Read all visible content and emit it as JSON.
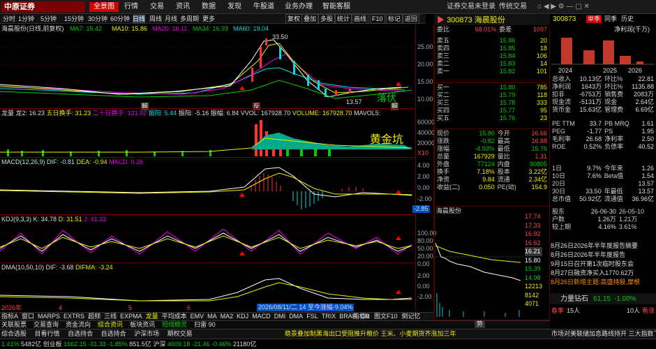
{
  "top_menu": {
    "logo": "中原证券",
    "logo_sub": "CENTRAL CHINA SECURITIES",
    "items": [
      "全景图",
      "行情",
      "交易",
      "资讯",
      "数据",
      "发现",
      "牛股道",
      "业务办理",
      "智能客服"
    ],
    "right": [
      "证券交易未登录",
      "传统交易"
    ]
  },
  "periods": [
    "分时",
    "1分钟",
    "5分钟",
    "15分钟",
    "30分钟",
    "60分钟",
    "日线",
    "周线",
    "月线",
    "多周期",
    "更多"
  ],
  "tools": [
    "复权",
    "叠加",
    "多股",
    "统计",
    "画线",
    "F10",
    "标记",
    "返回"
  ],
  "stock": {
    "code": "300873",
    "name": "海晨股份",
    "chart_title": "海晨股份(日线,前复权)"
  },
  "ma": {
    "ma7": "MA7: 15.42",
    "ma10": "MA10: 15.86",
    "ma20": "MA20: 16.11",
    "ma34": "MA34: 16.93",
    "ma60": "MA60: 19.04"
  },
  "price_axis": [
    "25.00",
    "20.00",
    "15.00",
    "10.00"
  ],
  "price_marks": {
    "high": "33.50",
    "low": "13.57",
    "tag1": "解",
    "tag2": "反",
    "tag3": "解",
    "tag4": "解",
    "tag5": "落伏"
  },
  "vol_ind": {
    "title": "龙量",
    "v1": "龙2: 16.23",
    "v2": "五日换手: 31.23",
    "v3": "二十日换手: 121.92",
    "v4": "振阳: 5.44",
    "v5": "振阳: -5.16",
    "v6": "振幅: 6.84",
    "v7": "VVOL: 167928.70",
    "v8": "VOLUME: 167928.70",
    "v9": "MAVOL5: "
  },
  "vol_axis": [
    "60000",
    "40000",
    "20000",
    "X10"
  ],
  "vol_label": "黄金坑",
  "macd": {
    "title": "MACD(12,26,9)",
    "dif": "DIF: -0.81",
    "dea": "DEA: -0.94",
    "macd": "MACD: 0.26",
    "axis": [
      "4.00",
      "2.00",
      "0.00",
      "-2.00"
    ],
    "current": "-2.85"
  },
  "kdj": {
    "title": "KDJ(9,3,3)",
    "k": "K: 34.78",
    "d": "D: 31.51",
    "j": "J: 41.33",
    "axis": [
      "100.00",
      "80.00",
      "50.00",
      "20.00",
      "0.00"
    ]
  },
  "dma": {
    "title": "DMA(10,50,10)",
    "dif": "DIF: -3.68",
    "difma": "DIFMA: -3.24",
    "axis": [
      "2.00",
      "0.00",
      "-2.00"
    ]
  },
  "time_axis": [
    "2026年",
    "4",
    "5",
    "6"
  ],
  "tooltip": "2026/08/11/二 14 至今涨幅-9.04%",
  "bottom_tabs": [
    "指标A",
    "窗口",
    "MARPS",
    "EXTRS",
    "超频",
    "三线",
    "EXPMA",
    "龙量",
    "平均成本",
    "EMV",
    "MA",
    "MA2",
    "KDJ",
    "MACD",
    "DMI",
    "DMA",
    "FSL",
    "TRIX",
    "BRAR",
    "CR"
  ],
  "bottom_tabs_right": [
    "指标B",
    "图文F10",
    "倒记忆"
  ],
  "lower_tabs": [
    "关联股票",
    "交易查询",
    "资金流向",
    "综合资讯",
    "板块资讯",
    "短线精灵",
    "扫雷 90"
  ],
  "ticker_text": "稳景叠加制黑海出口受阻推升粮价 王米、小麦期货齐涨加三年",
  "status_line": {
    "items": [
      "综合选股",
      "目看行情",
      "自选持合",
      "自选持合",
      "沪深市场",
      "期权交易"
    ],
    "quotes": [
      {
        "label": "1.41%",
        "v": "5482亿"
      },
      {
        "label": "创业板",
        "v": "1662.15"
      },
      {
        "label": "-31.33",
        "v": "-1.85%"
      },
      {
        "label": "851.5亿"
      },
      {
        "label": "沪深",
        "v": "4609.18"
      },
      {
        "label": "-21.46",
        "v": "-0.46%"
      },
      {
        "label": "21180亿"
      }
    ],
    "right": "市场对美联储加息路线持开 三大指数下跌"
  },
  "quote_panel": {
    "code": "300873",
    "name": "海晨股份",
    "weibi_label": "委比",
    "weibi": "68.01%",
    "weicha_label": "委差",
    "weicha": "1097",
    "sell": [
      {
        "l": "卖五",
        "p": "15.86",
        "v": "20"
      },
      {
        "l": "卖四",
        "p": "15.85",
        "v": "18"
      },
      {
        "l": "卖三",
        "p": "15.84",
        "v": "106"
      },
      {
        "l": "卖二",
        "p": "15.83",
        "v": "14"
      },
      {
        "l": "卖一",
        "p": "15.82",
        "v": "101"
      }
    ],
    "buy": [
      {
        "l": "买一",
        "p": "15.80",
        "v": "785"
      },
      {
        "l": "买二",
        "p": "15.79",
        "v": "118"
      },
      {
        "l": "买三",
        "p": "15.78",
        "v": "333"
      },
      {
        "l": "买四",
        "p": "15.77",
        "v": "95"
      },
      {
        "l": "买五",
        "p": "15.76",
        "v": "23"
      }
    ],
    "stats": [
      [
        "现价",
        "15.80",
        "今开",
        "16.66"
      ],
      [
        "涨跌",
        "-0.82",
        "最高",
        "16.88"
      ],
      [
        "涨幅",
        "-4.93%",
        "最低",
        "15.76"
      ],
      [
        "总量",
        "167929",
        "量比",
        "1.31"
      ],
      [
        "外盘",
        "77124",
        "内盘",
        "90805"
      ],
      [
        "换手",
        "7.18%",
        "股本",
        "3.22亿"
      ],
      [
        "净资",
        "9.84",
        "流通",
        "2.34亿"
      ],
      [
        "收益(二)",
        "0.050",
        "PE(动)",
        "154.9"
      ]
    ]
  },
  "mini_chart": {
    "title": "海晨股份",
    "axis": [
      "17.74",
      "17.33",
      "16.92",
      "16.62",
      "16.21",
      "15.80",
      "15.39",
      "14.98",
      "12213",
      "8142",
      "4071"
    ],
    "tab": "势"
  },
  "fin_panel": {
    "code": "300873",
    "tabs": [
      "单季",
      "同季",
      "历史"
    ],
    "chart_label": "净利润(千万)",
    "years": [
      "2024",
      "2025",
      "2026"
    ],
    "rows": [
      [
        "总收入",
        "10.13亿",
        "环比%",
        "22.81"
      ],
      [
        "净利润",
        "1643万",
        "环比%",
        "1135.88"
      ],
      [
        "扣非",
        "-6753万",
        "销售费",
        "2083万"
      ],
      [
        "现金流",
        "-5131万",
        "现金",
        "2.64亿"
      ],
      [
        "货币金",
        "15.63亿",
        "管理费",
        "6.69亿"
      ]
    ],
    "rows2": [
      [
        "PE TTM",
        "33.7",
        "PB MRQ",
        "1.61"
      ],
      [
        "PEG",
        "-1.77",
        "PS",
        "1.95"
      ],
      [
        "毛利率",
        "26.68",
        "净利率",
        "2.50"
      ],
      [
        "ROE",
        "0.52%",
        "负债率",
        "40.52"
      ]
    ],
    "rows3": [
      [
        "1日",
        "9.7%",
        "今年来",
        "1.26"
      ],
      [
        "10日",
        "7.6%",
        "Beta值",
        "1.54"
      ],
      [
        "20日",
        "",
        "",
        "13.57"
      ],
      [
        "30日",
        "33.50",
        "年最低",
        "13.57"
      ],
      [
        "总市值",
        "50.92亿",
        "流通值",
        "36.96亿"
      ]
    ],
    "holders": [
      [
        "股东",
        "26-06-30",
        "26-05-10"
      ],
      [
        "户数",
        "1.26万",
        "1.21万"
      ],
      [
        "较上期",
        "4.16%",
        "3.61%"
      ]
    ],
    "news": [
      "8月26日2026年半年度报告摘要",
      "8月26日2026年半年度报告",
      "9月15日召开第1次临时股东会",
      "8月27日融资净买入1770.62万",
      "8月26日新增主题:高盛持股,摩根"
    ],
    "bottom": {
      "label": "力量钻石",
      "v1": "61.15",
      "v2": "-1.00%",
      "tab1": "春季",
      "tab2": "15人",
      "tab3": "10人",
      "tab4": "看涨"
    }
  }
}
